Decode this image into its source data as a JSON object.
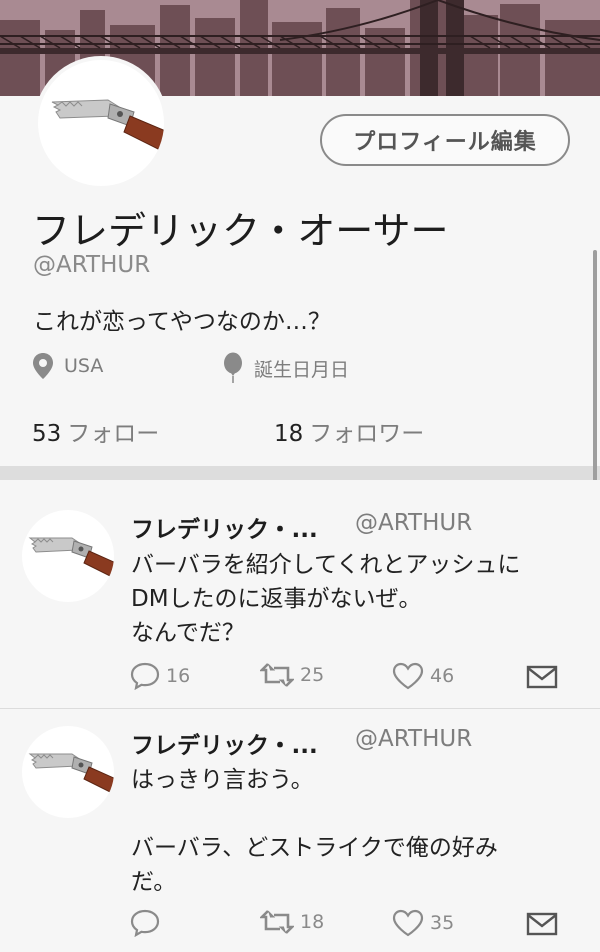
{
  "profile": {
    "edit_button": "プロフィール編集",
    "display_name": "フレデリック・オーサー",
    "handle": "@ARTHUR",
    "bio": "これが恋ってやつなのか…？",
    "location": "USA",
    "birthday": "誕生日月日",
    "following_count": "53",
    "following_label": "フォロー",
    "followers_count": "18",
    "followers_label": "フォロワー",
    "location_icon": "location-pin-icon",
    "birthday_icon": "balloon-icon"
  },
  "tweets": [
    {
      "name": "フレデリック・...",
      "handle": "@ARTHUR",
      "text": "バーバラを紹介してくれとアッシュに\nDMしたのに返事がないぜ。\nなんでだ？",
      "replies": "16",
      "retweets": "25",
      "likes": "46"
    },
    {
      "name": "フレデリック・...",
      "handle": "@ARTHUR",
      "text": "はっきり言おう。\n\nバーバラ、どストライクで俺の好み\nだ。",
      "replies": "",
      "retweets": "18",
      "likes": "35"
    }
  ],
  "colors": {
    "background": "#f6f6f6",
    "separator": "#dddddd",
    "icon_gray": "#8a8a8a",
    "text_dark": "#222222"
  }
}
